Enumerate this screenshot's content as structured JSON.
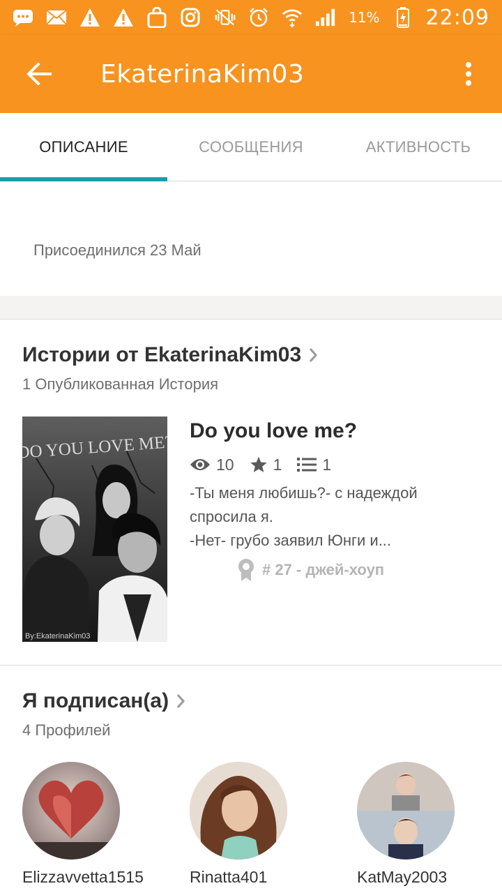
{
  "status_bar": {
    "battery": "11%",
    "time": "22:09"
  },
  "app_bar": {
    "title": "EkaterinaKim03"
  },
  "tabs": [
    {
      "label": "ОПИСАНИЕ",
      "active": true
    },
    {
      "label": "СООБЩЕНИЯ",
      "active": false
    },
    {
      "label": "АКТИВНОСТЬ",
      "active": false
    }
  ],
  "about": {
    "joined": "Присоединился 23 Май"
  },
  "stories_section": {
    "title": "Истории от EkaterinaKim03",
    "subtitle": "1 Опубликованная История",
    "story": {
      "title": "Do you love me?",
      "cover_text": "DO YOU LOVE ME?",
      "cover_credit": "By:EkaterinaKim03",
      "views": "10",
      "votes": "1",
      "parts": "1",
      "description_lines": [
        "-Ты меня любишь?- с надеждой",
        "спросила я.",
        "-Нет- грубо заявил Юнги и..."
      ],
      "rank": "# 27 - джей-хоуп"
    }
  },
  "following_section": {
    "title": "Я подписан(а)",
    "subtitle": "4 Профилей",
    "profiles": [
      {
        "name": "Elizzavvetta1515"
      },
      {
        "name": "Rinatta401"
      },
      {
        "name": "KatMay2003"
      }
    ]
  },
  "colors": {
    "brand_orange": "#f7931e",
    "tab_indicator": "#17a0aa"
  }
}
